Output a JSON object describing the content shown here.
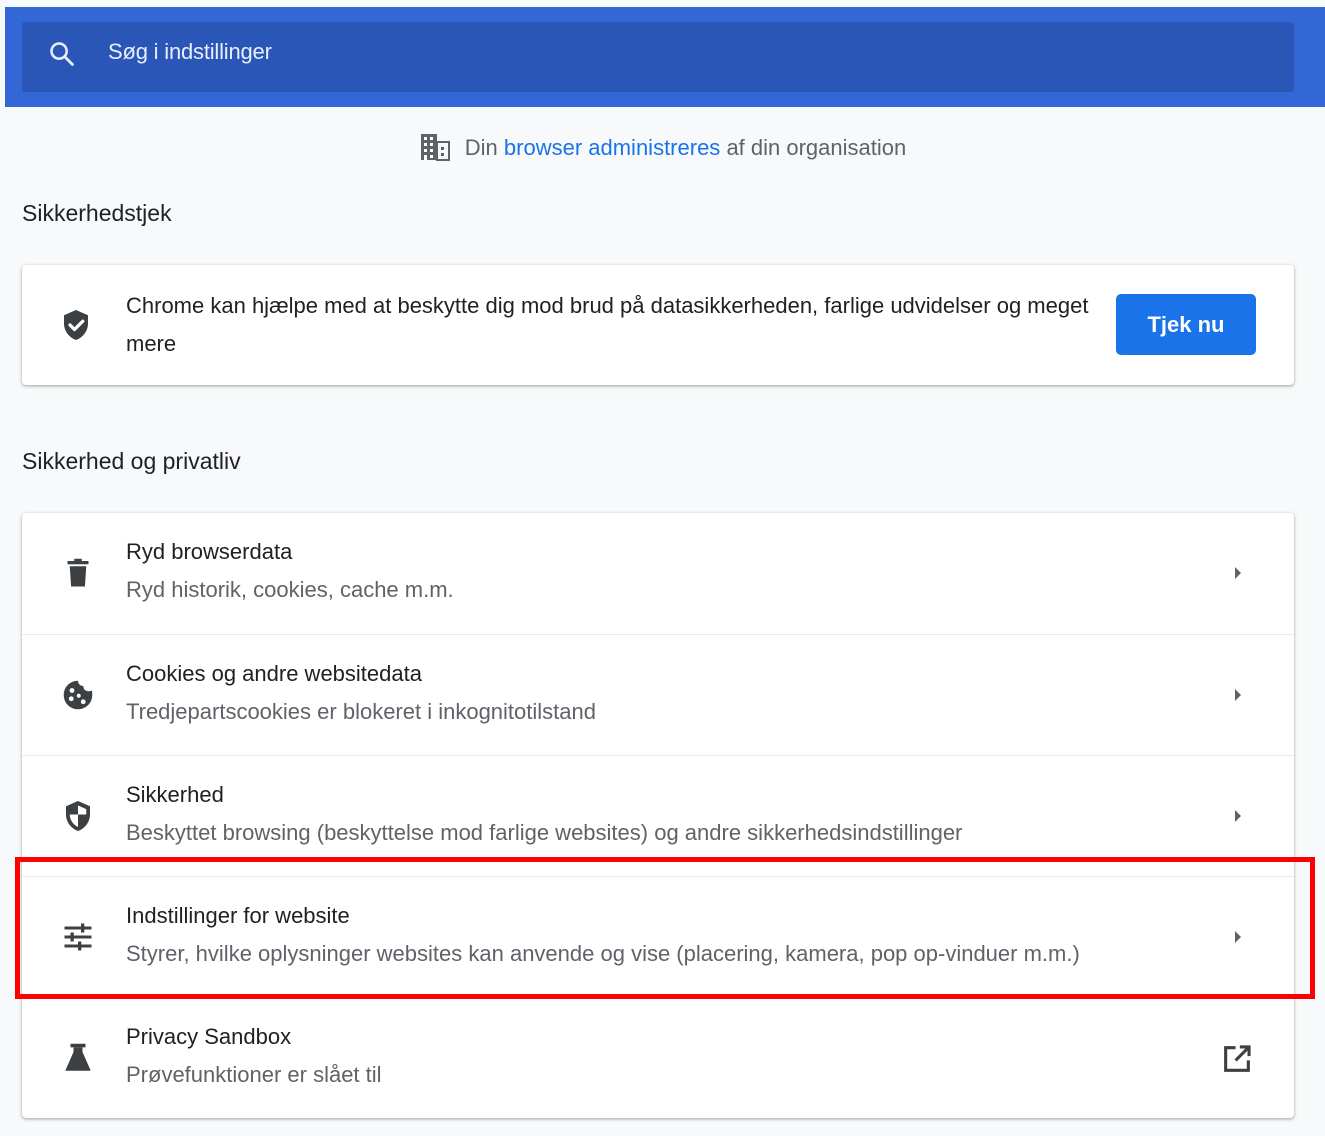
{
  "search": {
    "placeholder": "Søg i indstillinger",
    "icon": "search-icon"
  },
  "managed": {
    "prefix": "Din",
    "link": "browser administreres",
    "suffix": "af din organisation",
    "icon": "building-icon"
  },
  "safety_check": {
    "section_title": "Sikkerhedstjek",
    "text": "Chrome kan hjælpe med at beskytte dig mod brud på datasikkerheden, farlige udvidelser og meget mere",
    "button_label": "Tjek nu",
    "icon": "shield-check-icon"
  },
  "privacy": {
    "section_title": "Sikkerhed og privatliv",
    "items": [
      {
        "title": "Ryd browserdata",
        "subtitle": "Ryd historik, cookies, cache m.m.",
        "icon": "trash-icon",
        "action": "arrow-right-icon"
      },
      {
        "title": "Cookies og andre websitedata",
        "subtitle": "Tredjepartscookies er blokeret i inkognitotilstand",
        "icon": "cookie-icon",
        "action": "arrow-right-icon"
      },
      {
        "title": "Sikkerhed",
        "subtitle": "Beskyttet browsing (beskyttelse mod farlige websites) og andre sikkerhedsindstillinger",
        "icon": "security-shield-icon",
        "action": "arrow-right-icon"
      },
      {
        "title": "Indstillinger for website",
        "subtitle": "Styrer, hvilke oplysninger websites kan anvende og vise (placering, kamera, pop op-vinduer m.m.)",
        "icon": "sliders-icon",
        "action": "arrow-right-icon",
        "highlighted": true
      },
      {
        "title": "Privacy Sandbox",
        "subtitle": "Prøvefunktioner er slået til",
        "icon": "flask-icon",
        "action": "open-in-new-icon"
      }
    ]
  },
  "colors": {
    "header": "#3367d6",
    "search_bar": "#2a56b8",
    "accent": "#1a73e8",
    "highlight": "#ff0000",
    "background": "#f8f9fa"
  }
}
